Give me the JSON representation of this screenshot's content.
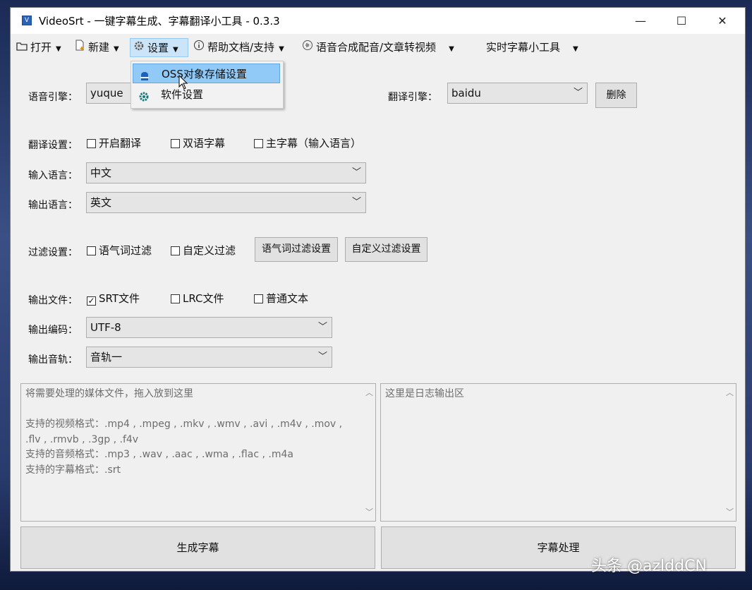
{
  "window": {
    "title": "VideoSrt - 一键字幕生成、字幕翻译小工具 - 0.3.3",
    "minimize": "—",
    "maximize": "☐",
    "close": "✕"
  },
  "menu": {
    "open": "打开",
    "new": "新建",
    "settings": "设置",
    "help": "帮助文档/支持",
    "tts": "语音合成配音/文章转视频",
    "realtime": "实时字幕小工具"
  },
  "settings_dropdown": {
    "items": [
      {
        "label": "OSS对象存储设置",
        "icon": "bucket-icon"
      },
      {
        "label": "软件设置",
        "icon": "gear-icon"
      }
    ]
  },
  "engine": {
    "speech_label": "语音引擎：",
    "speech_value": "yuque",
    "translate_label": "翻译引擎：",
    "translate_value": "baidu",
    "delete_label": "删除"
  },
  "translation": {
    "label": "翻译设置：",
    "enable": {
      "label": "开启翻译",
      "checked": false
    },
    "bilingual": {
      "label": "双语字幕",
      "checked": false
    },
    "main": {
      "label": "主字幕（输入语言）",
      "checked": false
    }
  },
  "input_lang": {
    "label": "输入语言：",
    "value": "中文"
  },
  "output_lang": {
    "label": "输出语言：",
    "value": "英文"
  },
  "filter": {
    "label": "过滤设置：",
    "modal": {
      "label": "语气词过滤",
      "checked": false
    },
    "custom": {
      "label": "自定义过滤",
      "checked": false
    },
    "modal_settings_btn": "语气词过滤设置",
    "custom_settings_btn": "自定义过滤设置"
  },
  "output_file": {
    "label": "输出文件：",
    "srt": {
      "label": "SRT文件",
      "checked": true
    },
    "lrc": {
      "label": "LRC文件",
      "checked": false
    },
    "txt": {
      "label": "普通文本",
      "checked": false
    }
  },
  "encoding": {
    "label": "输出编码：",
    "value": "UTF-8"
  },
  "track": {
    "label": "输出音轨：",
    "value": "音轨一"
  },
  "drop_area": {
    "lines": [
      "将需要处理的媒体文件，拖入放到这里",
      "",
      "支持的视频格式：.mp4 , .mpeg , .mkv , .wmv , .avi , .m4v , .mov ,",
      ".flv , .rmvb , .3gp , .f4v",
      "支持的音频格式：.mp3 , .wav , .aac , .wma , .flac , .m4a",
      "支持的字幕格式：.srt"
    ]
  },
  "log_area": {
    "text": "这里是日志输出区"
  },
  "actions": {
    "generate": "生成字幕",
    "process": "字幕处理"
  },
  "watermark": "头条 @azlddCN",
  "colors": {
    "window_bg": "#f0f0f0",
    "menu_active": "#cce4f7",
    "dropdown_highlight": "#91c9f7"
  }
}
